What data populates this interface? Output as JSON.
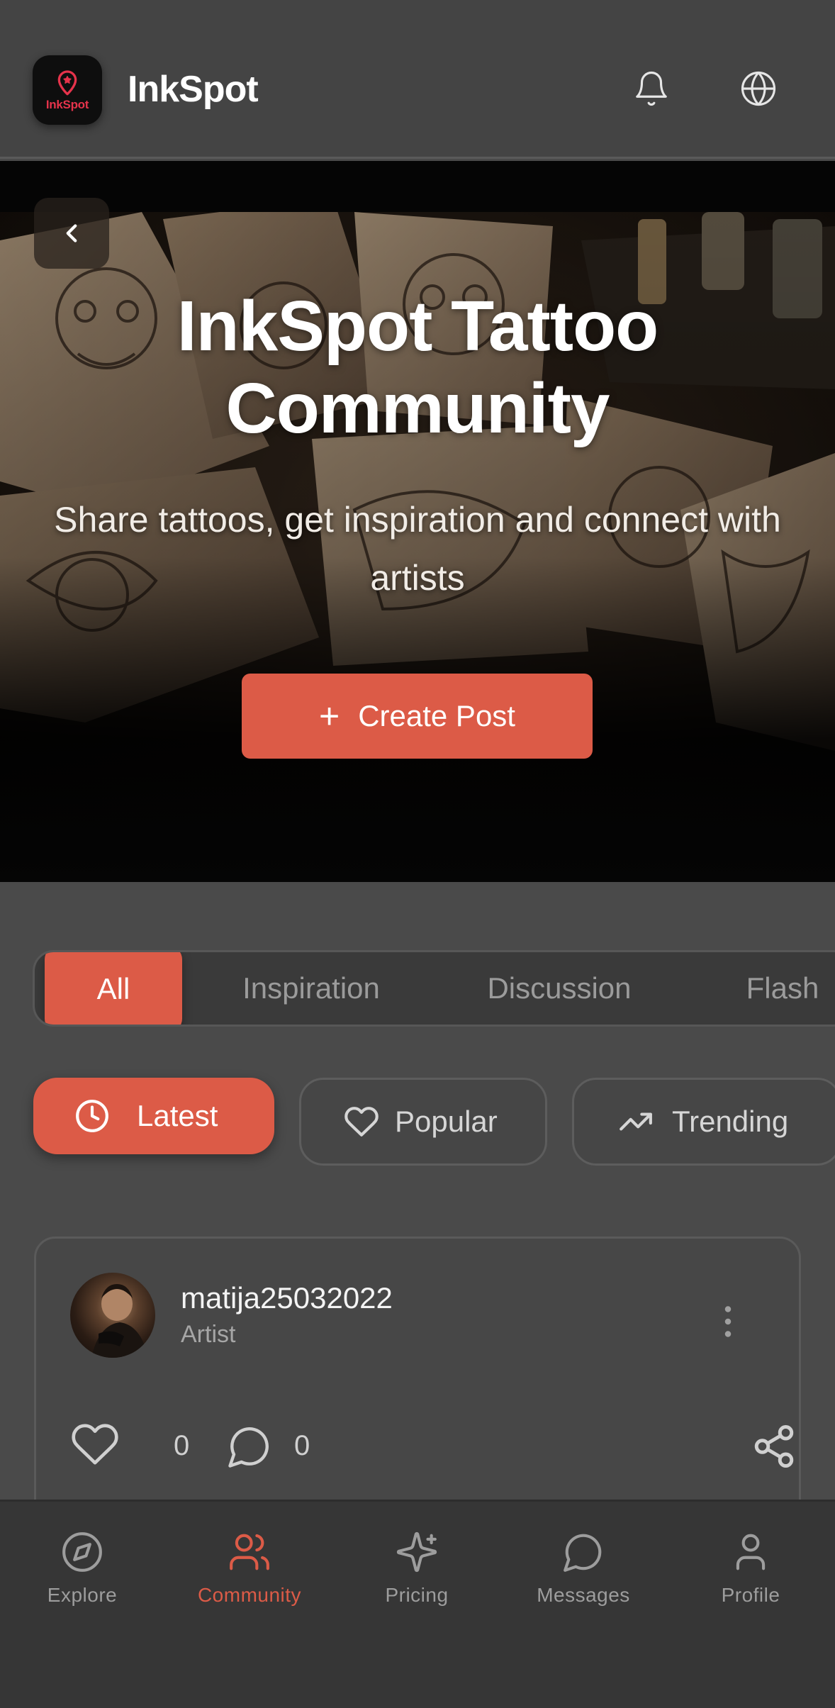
{
  "header": {
    "logo_text": "InkSpot",
    "app_name": "InkSpot",
    "icons": [
      "bell-icon",
      "globe-icon"
    ]
  },
  "hero": {
    "back_icon": "chevron-left-icon",
    "title": "InkSpot Tattoo Community",
    "subtitle": "Share tattoos, get inspiration and connect with artists",
    "create_post_label": "Create Post",
    "create_post_icon": "plus-icon"
  },
  "category_tabs": [
    {
      "label": "All",
      "active": true
    },
    {
      "label": "Inspiration",
      "active": false
    },
    {
      "label": "Discussion",
      "active": false
    },
    {
      "label": "Flash",
      "active": false
    }
  ],
  "sort_options": [
    {
      "label": "Latest",
      "icon": "clock-icon",
      "active": true
    },
    {
      "label": "Popular",
      "icon": "heart-icon",
      "active": false
    },
    {
      "label": "Trending",
      "icon": "trending-up-icon",
      "active": false
    }
  ],
  "post": {
    "username": "matija25032022",
    "role": "Artist",
    "likes": "0",
    "comments": "0"
  },
  "bottom_nav": [
    {
      "label": "Explore",
      "icon": "compass-icon",
      "active": false
    },
    {
      "label": "Community",
      "icon": "users-icon",
      "active": true
    },
    {
      "label": "Pricing",
      "icon": "sparkles-icon",
      "active": false
    },
    {
      "label": "Messages",
      "icon": "message-circle-icon",
      "active": false
    },
    {
      "label": "Profile",
      "icon": "user-icon",
      "active": false
    }
  ],
  "colors": {
    "accent": "#dc5b47",
    "background": "#4a4a4a",
    "header": "#444444",
    "nav": "#363636",
    "logo_text": "#e5334b"
  }
}
